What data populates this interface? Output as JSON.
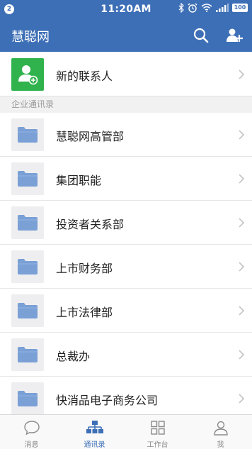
{
  "status_bar": {
    "notification_count": "2",
    "time": "11:20AM",
    "battery": "100"
  },
  "app_bar": {
    "title": "慧聪网",
    "icons": [
      "search-icon",
      "add-user-icon"
    ]
  },
  "new_contacts": {
    "label": "新的联系人"
  },
  "section": {
    "title": "企业通讯录"
  },
  "departments": [
    {
      "label": "慧聪网高管部"
    },
    {
      "label": "集团职能"
    },
    {
      "label": "投资者关系部"
    },
    {
      "label": "上市财务部"
    },
    {
      "label": "上市法律部"
    },
    {
      "label": "总裁办"
    },
    {
      "label": "快消品电子商务公司"
    }
  ],
  "tabs": [
    {
      "label": "消息",
      "icon": "chat-bubble-icon",
      "active": false
    },
    {
      "label": "通讯录",
      "icon": "org-chart-icon",
      "active": true
    },
    {
      "label": "工作台",
      "icon": "grid-icon",
      "active": false
    },
    {
      "label": "我",
      "icon": "person-icon",
      "active": false
    }
  ],
  "colors": {
    "primary": "#3d6fb6",
    "new_contact_green": "#30b24d",
    "folder_blue": "#7aa0d6",
    "folder_tile_bg": "#eeeef0"
  }
}
